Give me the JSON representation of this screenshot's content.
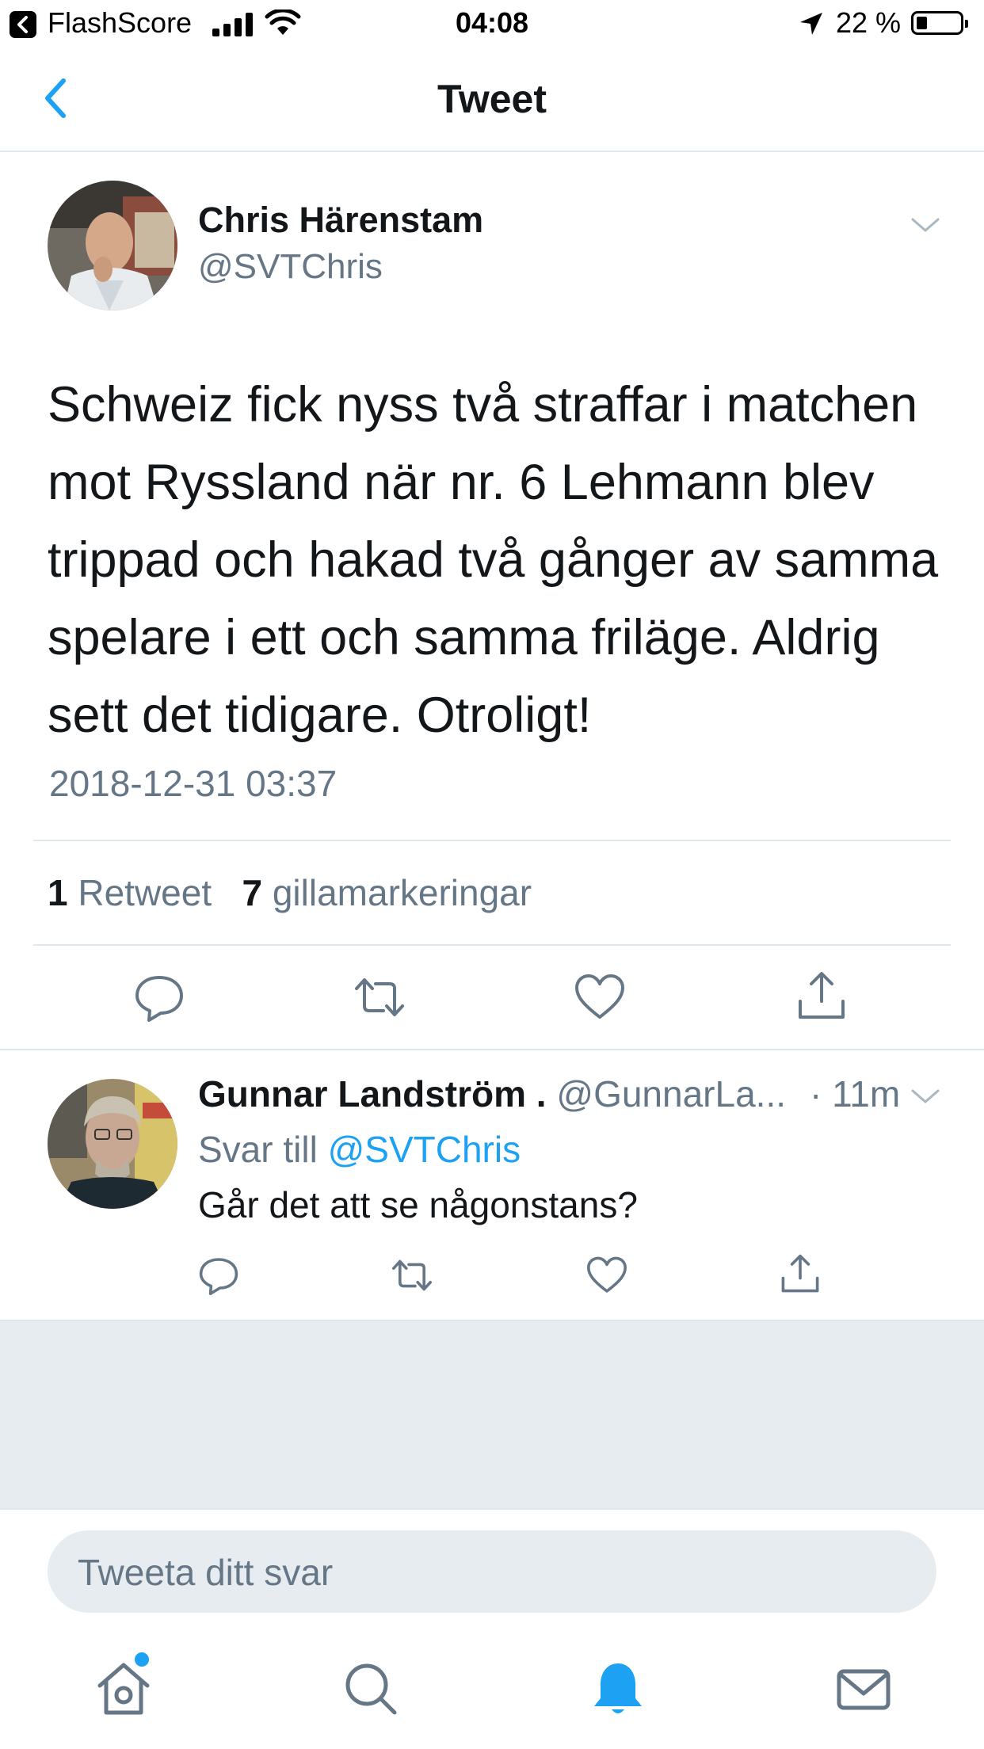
{
  "status_bar": {
    "app_name": "FlashScore",
    "time": "04:08",
    "battery": "22 %"
  },
  "nav": {
    "title": "Tweet"
  },
  "tweet": {
    "author_name": "Chris Härenstam",
    "author_handle": "@SVTChris",
    "text": "Schweiz fick nyss två straffar i matchen mot Ryssland när nr. 6 Lehmann blev trippad och hakad två gånger av samma spelare i ett och samma friläge. Aldrig sett det tidigare. Otroligt!",
    "timestamp": "2018-12-31 03:37",
    "retweet_count": "1",
    "retweet_label": "Retweet",
    "like_count": "7",
    "like_label": "gillamarkeringar"
  },
  "reply": {
    "author_name": "Gunnar Landström .",
    "author_handle": "@GunnarLa...",
    "time": "· 11m",
    "reply_to_label": "Svar till",
    "reply_to_mention": "@SVTChris",
    "text": "Går det att se någonstans?"
  },
  "compose": {
    "placeholder": "Tweeta ditt svar"
  },
  "tabs": [
    "home-icon",
    "search-icon",
    "bell-icon",
    "mail-icon"
  ],
  "colors": {
    "accent": "#1da1f2",
    "secondary_text": "#657786",
    "gray_background": "#e6ecf0"
  }
}
